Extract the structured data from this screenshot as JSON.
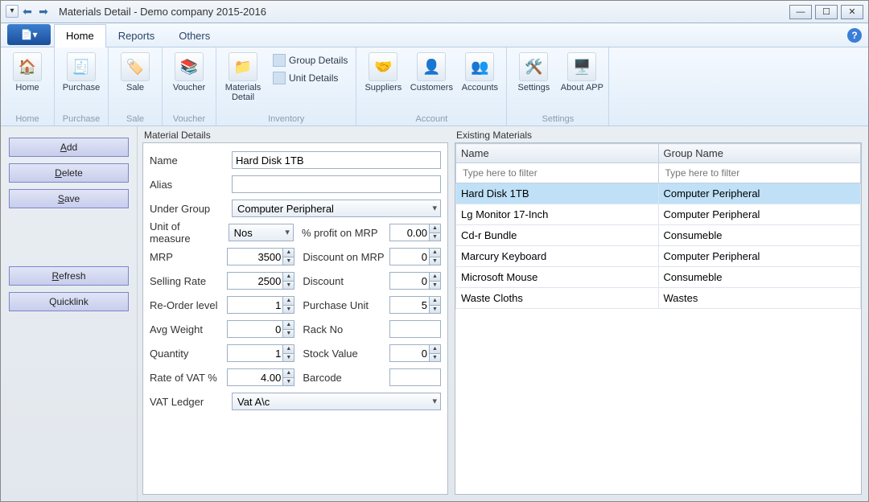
{
  "title": "Materials Detail - Demo company 2015-2016",
  "tabs": [
    "Home",
    "Reports",
    "Others"
  ],
  "active_tab": "Home",
  "ribbon": {
    "groups": [
      {
        "label": "Home",
        "items": [
          {
            "label": "Home"
          }
        ]
      },
      {
        "label": "Purchase",
        "items": [
          {
            "label": "Purchase"
          }
        ]
      },
      {
        "label": "Sale",
        "items": [
          {
            "label": "Sale"
          }
        ]
      },
      {
        "label": "Voucher",
        "items": [
          {
            "label": "Voucher"
          }
        ]
      },
      {
        "label": "Inventory",
        "items": [
          {
            "label": "Materials Detail"
          }
        ],
        "small": [
          "Group Details",
          "Unit Details"
        ]
      },
      {
        "label": "Account",
        "items": [
          {
            "label": "Suppliers"
          },
          {
            "label": "Customers"
          },
          {
            "label": "Accounts"
          }
        ]
      },
      {
        "label": "Settings",
        "items": [
          {
            "label": "Settings"
          },
          {
            "label": "About APP"
          }
        ]
      }
    ]
  },
  "leftButtons": {
    "add": "Add",
    "delete": "Delete",
    "save": "Save",
    "refresh": "Refresh",
    "quicklink": "Quicklink"
  },
  "materialDetails": {
    "heading": "Material Details",
    "labels": {
      "name": "Name",
      "alias": "Alias",
      "underGroup": "Under Group",
      "uom": "Unit of measure",
      "profitMrp": "% profit on MRP",
      "mrp": "MRP",
      "discMrp": "Discount on MRP",
      "sellingRate": "Selling Rate",
      "discount": "Discount",
      "reorder": "Re-Order level",
      "purchaseUnit": "Purchase Unit",
      "avgWeight": "Avg Weight",
      "rackNo": "Rack No",
      "quantity": "Quantity",
      "stockValue": "Stock Value",
      "vatRate": "Rate of VAT %",
      "barcode": "Barcode",
      "vatLedger": "VAT Ledger"
    },
    "values": {
      "name": "Hard Disk 1TB",
      "alias": "",
      "underGroup": "Computer Peripheral",
      "uom": "Nos",
      "profitMrp": "0.00",
      "mrp": "3500",
      "discMrp": "0",
      "sellingRate": "2500",
      "discount": "0",
      "reorder": "1",
      "purchaseUnit": "5",
      "avgWeight": "0",
      "rackNo": "",
      "quantity": "1",
      "stockValue": "0",
      "vatRate": "4.00",
      "barcode": "",
      "vatLedger": "Vat A\\c"
    }
  },
  "existing": {
    "heading": "Existing Materials",
    "columns": [
      "Name",
      "Group Name"
    ],
    "filterPlaceholder": "Type here to filter",
    "rows": [
      {
        "name": "Hard Disk 1TB",
        "group": "Computer Peripheral",
        "selected": true
      },
      {
        "name": "Lg Monitor 17-Inch",
        "group": "Computer Peripheral"
      },
      {
        "name": "Cd-r Bundle",
        "group": "Consumeble"
      },
      {
        "name": "Marcury Keyboard",
        "group": "Computer Peripheral"
      },
      {
        "name": "Microsoft Mouse",
        "group": "Consumeble"
      },
      {
        "name": "Waste Cloths",
        "group": "Wastes"
      }
    ]
  }
}
